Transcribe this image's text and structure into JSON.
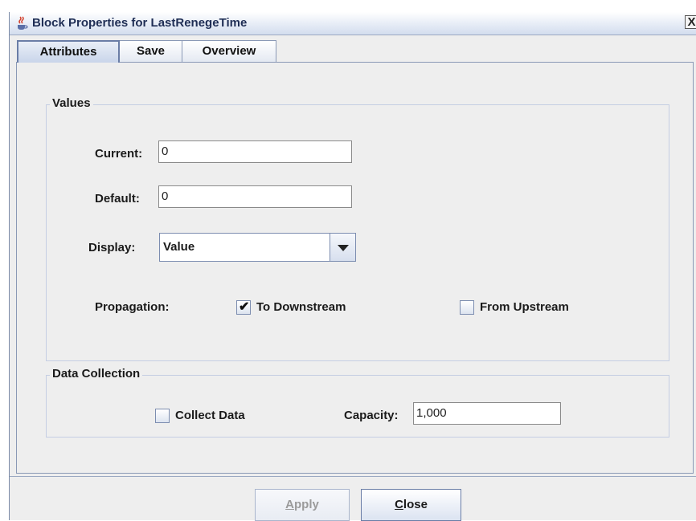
{
  "window": {
    "title": "Block Properties for LastRenegeTime",
    "icon": "java-cup-icon",
    "close_glyph": "X"
  },
  "tabs": [
    {
      "label": "Attributes",
      "active": true
    },
    {
      "label": "Save",
      "active": false
    },
    {
      "label": "Overview",
      "active": false
    }
  ],
  "values_group": {
    "title": "Values",
    "current": {
      "label": "Current:",
      "value": "0"
    },
    "default": {
      "label": "Default:",
      "value": "0"
    },
    "display": {
      "label": "Display:",
      "selected": "Value"
    },
    "propagation": {
      "label": "Propagation:",
      "to_downstream": {
        "label": "To Downstream",
        "checked": true
      },
      "from_upstream": {
        "label": "From Upstream",
        "checked": false
      }
    }
  },
  "data_collection_group": {
    "title": "Data Collection",
    "collect_data": {
      "label": "Collect Data",
      "checked": false
    },
    "capacity": {
      "label": "Capacity:",
      "value": "1,000"
    }
  },
  "buttons": {
    "apply": {
      "label_mnemonic": "A",
      "label_rest": "pply",
      "enabled": false
    },
    "close": {
      "label_mnemonic": "C",
      "label_rest": "lose",
      "enabled": true
    }
  },
  "colors": {
    "title_text": "#1f2e55",
    "panel_bg": "#eeeeee",
    "border_accent": "#8a99b6"
  }
}
